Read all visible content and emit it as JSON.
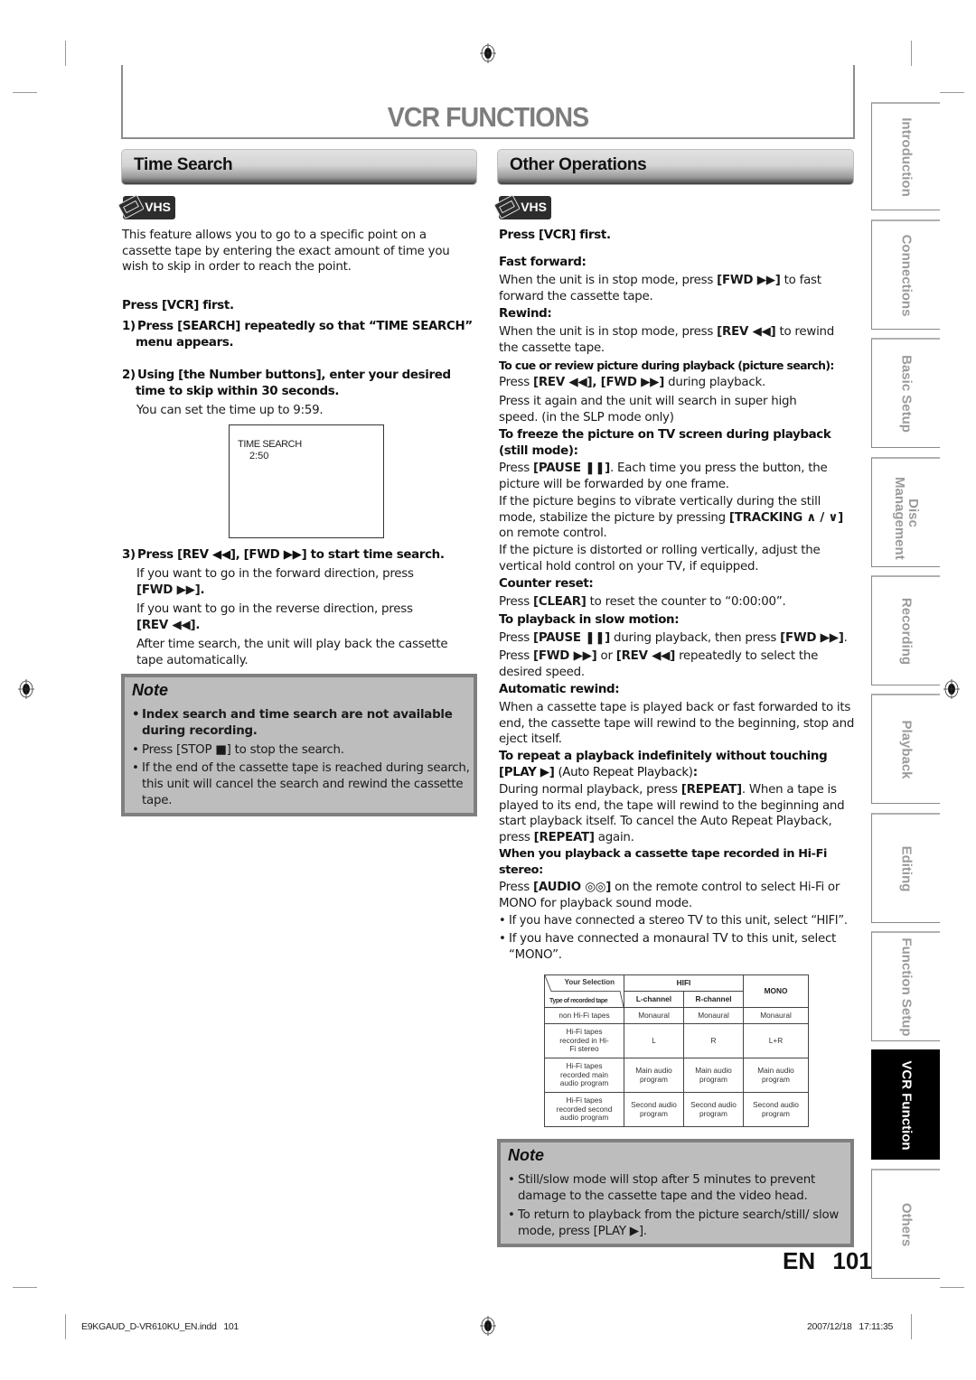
{
  "page": {
    "title": "VCR FUNCTIONS",
    "language": "EN",
    "page_number": "101"
  },
  "time_search": {
    "header": "Time Search",
    "badge": "VHS",
    "intro": "This feature allows you to go to a specific point on a cassette tape by entering the exact amount of time you wish to skip in order to reach the point.",
    "press_first": "Press [VCR] first.",
    "step1": "1) Press [SEARCH] repeatedly so that “TIME SEARCH” menu appears.",
    "step2": "2) Using [the Number buttons], enter your desired time to skip within 30 seconds.",
    "step2_note": "You can set the time up to 9:59.",
    "osd": {
      "line1": "TIME SEARCH",
      "line2": "2:50"
    },
    "step3": "3) Press [REV ◀◀], [FWD ▶▶] to start time search.",
    "step3_fwd_text": "If you want to go in the forward direction, press",
    "step3_fwd_key": "[FWD ▶▶].",
    "step3_rev_text": "If you want to go in the reverse direction, press",
    "step3_rev_key": "[REV ◀◀].",
    "step3_after": "After time search, the unit will play back the cassette tape automatically.",
    "note": {
      "title": "Note",
      "items": [
        "Index search and time search are not available during recording.",
        "Press [STOP ■] to stop the search.",
        "If the end of the cassette tape is reached during search, this unit will cancel the search and rewind the cassette tape."
      ]
    }
  },
  "other_operations": {
    "header": "Other Operations",
    "badge": "VHS",
    "press_first": "Press [VCR] first.",
    "sections": [
      {
        "heading": "Fast forward:",
        "pre": "When the unit is in stop mode, press ",
        "key": "[FWD ▶▶]",
        "post": " to fast forward the cassette tape."
      },
      {
        "heading": "Rewind:",
        "pre": "When the unit is in stop mode, press ",
        "key": "[REV ◀◀]",
        "post": " to rewind the cassette tape."
      },
      {
        "heading": "To cue or review picture during playback (picture search):",
        "pre": "Press ",
        "key": "[REV ◀◀], [FWD ▶▶]",
        "post": " during playback.",
        "extra": "Press it again and the unit will search in super high speed. (in the SLP mode only)"
      },
      {
        "heading": "To freeze the picture on TV screen during playback (still mode):",
        "pre": "Press ",
        "key": "[PAUSE ❚❚]",
        "post": ". Each time you press the button, the picture will be forwarded by one frame.",
        "extra_pre": "If the picture begins to vibrate vertically during the still mode, stabilize the picture by pressing ",
        "extra_key": "[TRACKING ∧ / ∨]",
        "extra_post": " on remote control.",
        "extra2": "If the picture is distorted or rolling vertically, adjust the vertical hold control on your TV, if equipped."
      },
      {
        "heading": "Counter reset:",
        "pre": "Press ",
        "key": "[CLEAR]",
        "post": " to reset the counter to “0:00:00”."
      },
      {
        "heading": "To playback in slow motion:",
        "pre": "Press ",
        "key": "[PAUSE ❚❚]",
        "post": " during playback, then press ",
        "key2": "[FWD ▶▶]",
        "post2": ".",
        "l2_pre": "Press ",
        "l2_key": "[FWD ▶▶]",
        "l2_mid": " or ",
        "l2_key2": "[REV ◀◀]",
        "l2_post": " repeatedly to select the desired speed."
      },
      {
        "heading": "Automatic rewind:",
        "body": "When a cassette tape is played back or fast forwarded to its end, the cassette tape will rewind to the beginning, stop and eject itself."
      },
      {
        "heading": "To repeat a playback indefinitely without touching",
        "heading2_key": "[PLAY ▶]",
        "heading2_text": " (Auto Repeat Playback)",
        "heading2_colon": ":",
        "pre": "During normal playback, press ",
        "key": "[REPEAT]",
        "post": ". When a tape is played to its end, the tape will rewind to the beginning and start playback itself. To cancel the Auto Repeat Playback, press ",
        "key2": "[REPEAT]",
        "post2": " again."
      },
      {
        "heading": "When you playback a cassette tape recorded in Hi-Fi stereo:",
        "pre": "Press ",
        "key": "[AUDIO ◎◎]",
        "post": " on the remote control to select Hi-Fi or MONO for playback sound mode.",
        "bullets": [
          "If you have connected a stereo TV to this unit, select “HIFI”.",
          "If you have connected a monaural TV to this unit, select “MONO”."
        ]
      }
    ],
    "table": {
      "corner_top": "Your Selection",
      "corner_bottom": "Type of recorded tape",
      "group_hifi": "HIFI",
      "col_mono": "MONO",
      "col_l": "L-channel",
      "col_r": "R-channel",
      "rows": [
        {
          "type": "non Hi-Fi tapes",
          "l": "Monaural",
          "r": "Monaural",
          "mono": "Monaural"
        },
        {
          "type": "Hi-Fi tapes recorded in Hi-Fi stereo",
          "l": "L",
          "r": "R",
          "mono": "L+R"
        },
        {
          "type": "Hi-Fi tapes recorded main audio program",
          "l": "Main audio program",
          "r": "Main audio program",
          "mono": "Main audio program"
        },
        {
          "type": "Hi-Fi tapes recorded second audio program",
          "l": "Second audio program",
          "r": "Second audio program",
          "mono": "Second audio program"
        }
      ]
    },
    "note": {
      "title": "Note",
      "items": [
        "Still/slow mode will stop after 5 minutes to prevent damage to the cassette tape and the video head.",
        "To return to playback from the picture search/still/ slow mode, press [PLAY ▶]."
      ]
    }
  },
  "side_tabs": [
    {
      "label": "Introduction",
      "active": false
    },
    {
      "label": "Connections",
      "active": false
    },
    {
      "label": "Basic Setup",
      "active": false
    },
    {
      "label": "Disc Management",
      "active": false
    },
    {
      "label": "Recording",
      "active": false
    },
    {
      "label": "Playback",
      "active": false
    },
    {
      "label": "Editing",
      "active": false
    },
    {
      "label": "Function Setup",
      "active": false
    },
    {
      "label": "VCR Function",
      "active": true
    },
    {
      "label": "Others",
      "active": false
    }
  ],
  "footer": {
    "file": "E9KGAUD_D-VR610KU_EN.indd   101",
    "timestamp": "2007/12/18   17:11:35"
  }
}
